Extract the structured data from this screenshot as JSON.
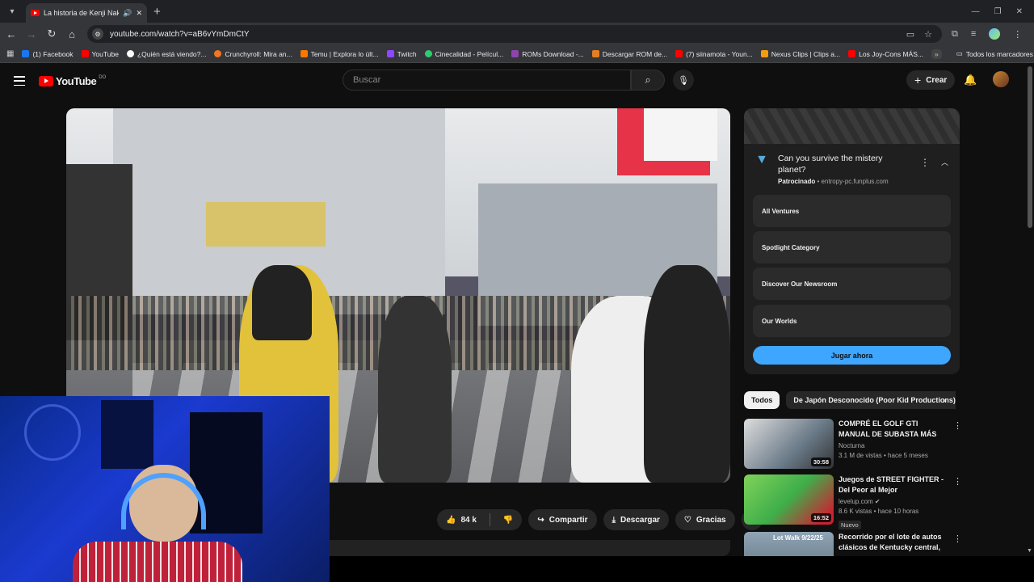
{
  "browser": {
    "tab_title": "La historia de Kenji Nakam",
    "url": "youtube.com/watch?v=aB6vYmDmCtY",
    "bookmarks": [
      {
        "label": "(1) Facebook",
        "color": "#1877f2"
      },
      {
        "label": "YouTube",
        "color": "#ff0000"
      },
      {
        "label": "¿Quién está viendo?...",
        "color": "#ffffff"
      },
      {
        "label": "Crunchyroll: Mira an...",
        "color": "#f47521"
      },
      {
        "label": "Temu | Explora lo últ...",
        "color": "#fb7701"
      },
      {
        "label": "Twitch",
        "color": "#9146ff"
      },
      {
        "label": "Cinecalidad - Películ...",
        "color": "#2ecc71"
      },
      {
        "label": "ROMs Download -...",
        "color": "#8e44ad"
      },
      {
        "label": "Descargar ROM de...",
        "color": "#e67e22"
      },
      {
        "label": "(7) siinamota - Youn...",
        "color": "#ff0000"
      },
      {
        "label": "Nexus Clips | Clips a...",
        "color": "#f39c12"
      },
      {
        "label": "Los Joy-Cons MÁS...",
        "color": "#ff0000"
      }
    ],
    "all_bookmarks": "Todos los marcadores"
  },
  "header": {
    "logo_text": "YouTube",
    "logo_country": "DO",
    "search_placeholder": "Buscar",
    "create_label": "Crear"
  },
  "actions": {
    "likes": "84 k",
    "share": "Compartir",
    "download": "Descargar",
    "thanks": "Gracias"
  },
  "ad": {
    "title": "Can you survive the mistery planet?",
    "sponsored": "Patrocinado",
    "domain": "entropy-pc.funplus.com",
    "options": [
      "All Ventures",
      "Spotlight Category",
      "Discover Our Newsroom",
      "Our Worlds"
    ],
    "cta": "Jugar ahora"
  },
  "chips": [
    "Todos",
    "De Japón Desconocido (Poor Kid Productions)"
  ],
  "recommendations": [
    {
      "title": "COMPRÉ EL GOLF GTI MANUAL DE SUBASTA MÁS BARATO D...",
      "channel": "Nocturna",
      "meta": "3.1 M de vistas • hace 5 meses",
      "duration": "30:58",
      "thumb_color": "#6a7a88"
    },
    {
      "title": "Juegos de STREET FIGHTER - Del Peor al Mejor",
      "channel": "levelup.com",
      "meta": "8.6 K vistas • hace 10 horas",
      "badge": "Nuevo",
      "duration": "16:52",
      "thumb_color": "#3fae4a"
    },
    {
      "title": "Recorrido por el lote de autos clásicos de Kentucky central, ...",
      "thumb_text": "Lot Walk 9/22/25",
      "thumb_color": "#8fa4b5"
    }
  ]
}
